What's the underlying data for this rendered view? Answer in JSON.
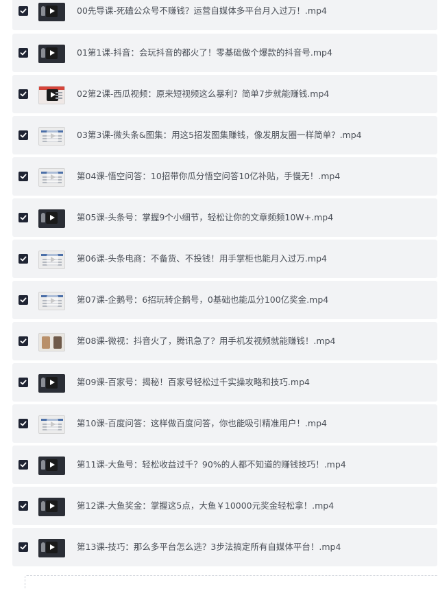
{
  "file_list": {
    "items": [
      {
        "name": "00先导课-死磕公众号不赚钱？运营自媒体多平台月入过万！.mp4",
        "checked": true,
        "thumb": "dark"
      },
      {
        "name": "01第1课-抖音：会玩抖音的都火了！零基础做个爆款的抖音号.mp4",
        "checked": true,
        "thumb": "dark"
      },
      {
        "name": "02第2课-西瓜视频：原来短视频这么暴利？简单7步就能赚钱.mp4",
        "checked": true,
        "thumb": "red"
      },
      {
        "name": "03第3课-微头条&图集：用这5招发图集赚钱，像发朋友圈一样简单？.mp4",
        "checked": true,
        "thumb": "light"
      },
      {
        "name": "第04课-悟空问答：10招带你瓜分悟空问答10亿补贴，手慢无！.mp4",
        "checked": true,
        "thumb": "light"
      },
      {
        "name": "第05课-头条号：掌握9个小细节，轻松让你的文章频频10W+.mp4",
        "checked": true,
        "thumb": "dark"
      },
      {
        "name": "第06课-头条电商：不备货、不投钱！用手掌柜也能月入过万.mp4",
        "checked": true,
        "thumb": "light"
      },
      {
        "name": "第07课-企鹅号：6招玩转企鹅号，0基础也能瓜分100亿奖金.mp4",
        "checked": true,
        "thumb": "light"
      },
      {
        "name": "第08课-微视：抖音火了，腾讯急了？用手机发视频就能赚钱！.mp4",
        "checked": true,
        "thumb": "photo"
      },
      {
        "name": "第09课-百家号：揭秘！百家号轻松过千实操攻略和技巧.mp4",
        "checked": true,
        "thumb": "dark"
      },
      {
        "name": "第10课-百度问答：这样做百度问答，你也能吸引精准用户！.mp4",
        "checked": true,
        "thumb": "light"
      },
      {
        "name": "第11课-大鱼号：轻松收益过千？90%的人都不知道的赚钱技巧！.mp4",
        "checked": true,
        "thumb": "dark"
      },
      {
        "name": "第12课-大鱼奖金：掌握这5点，大鱼￥10000元奖金轻松拿！.mp4",
        "checked": true,
        "thumb": "dark"
      },
      {
        "name": "第13课-技巧：那么多平台怎么选？3步法搞定所有自媒体平台！.mp4",
        "checked": true,
        "thumb": "dark"
      }
    ]
  },
  "icons": {
    "checkbox": "checkbox-checked-icon",
    "thumbnail": "video-thumbnail-icon",
    "play": "play-icon"
  },
  "colors": {
    "row_bg": "#f2f3f5",
    "checkbox": "#1f2433",
    "text": "#4a4f57"
  }
}
